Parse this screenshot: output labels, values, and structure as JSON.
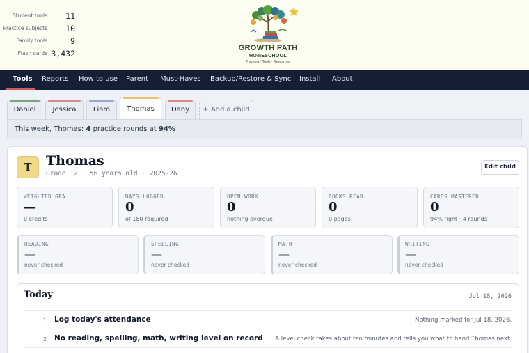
{
  "header": {
    "stats": [
      {
        "label": "Student tools",
        "value": "11"
      },
      {
        "label": "Practice subjects",
        "value": "10"
      },
      {
        "label": "Family tools",
        "value": "9"
      },
      {
        "label": "Flash cards",
        "value": "3,432"
      }
    ],
    "logo": {
      "title": "GROWTH PATH",
      "subtitle": "HOMESCHOOL",
      "tagline": "Tracking · Tools · Resources"
    }
  },
  "nav": {
    "active": "Tools",
    "items": [
      "Tools",
      "Reports",
      "How to use",
      "Parent",
      "Must-Haves",
      "Backup/Restore & Sync",
      "Install",
      "About"
    ],
    "accent": "#d45a5a"
  },
  "children": {
    "active": "Thomas",
    "tabs": [
      {
        "name": "Daniel",
        "color": "#7aa37a"
      },
      {
        "name": "Jessica",
        "color": "#d98a8a"
      },
      {
        "name": "Liam",
        "color": "#9aa6d6"
      },
      {
        "name": "Thomas",
        "color": "#e9c46a"
      },
      {
        "name": "Dany",
        "color": "#e08a8a"
      }
    ],
    "add_label": "+ Add a child"
  },
  "week_banner": {
    "prefix": "This week, Thomas: ",
    "rounds": "4",
    "middle": " practice rounds at ",
    "accuracy": "94%"
  },
  "profile": {
    "initial": "T",
    "name": "Thomas",
    "meta": "Grade 12 · 56 years old · 2025-26",
    "edit_label": "Edit child"
  },
  "stats": [
    {
      "label": "WEIGHTED GPA",
      "value": "—",
      "sub": "0 credits"
    },
    {
      "label": "DAYS LOGGED",
      "value": "0",
      "sub": "of 180 required"
    },
    {
      "label": "OPEN WORK",
      "value": "0",
      "sub": "nothing overdue"
    },
    {
      "label": "BOOKS READ",
      "value": "0",
      "sub": "0 pages"
    },
    {
      "label": "CARDS MASTERED",
      "value": "0",
      "sub": "94% right · 4 rounds"
    }
  ],
  "skills": [
    {
      "label": "READING",
      "value": "—",
      "sub": "never checked"
    },
    {
      "label": "SPELLING",
      "value": "—",
      "sub": "never checked"
    },
    {
      "label": "MATH",
      "value": "—",
      "sub": "never checked"
    },
    {
      "label": "WRITING",
      "value": "—",
      "sub": "never checked"
    }
  ],
  "today": {
    "title": "Today",
    "date": "Jul 18, 2026",
    "tasks": [
      {
        "num": "1",
        "title": "Log today's attendance",
        "note": "Nothing marked for Jul 18, 2026."
      },
      {
        "num": "2",
        "title": "No reading, spelling, math, writing level on record",
        "note": "A level check takes about ten minutes and tells you what to hand Thomas next."
      }
    ]
  }
}
